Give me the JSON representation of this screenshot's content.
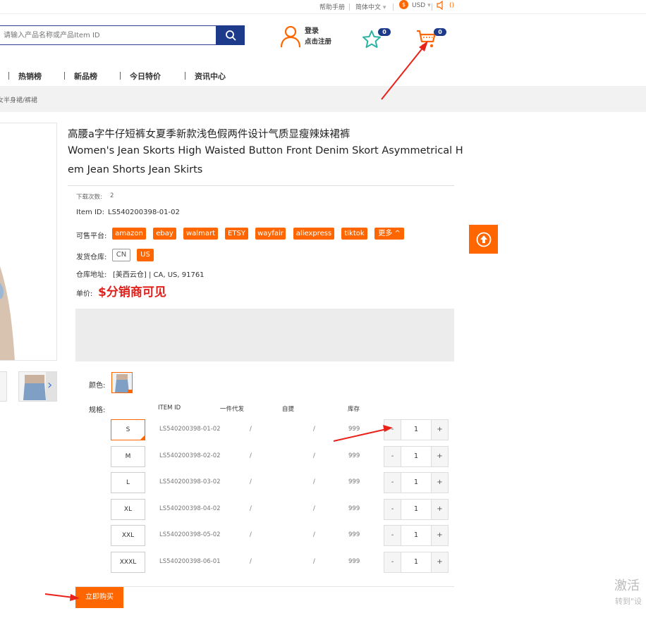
{
  "topbar": {
    "help": "帮助手册",
    "language": "简体中文",
    "currency": "USD",
    "volume": "()"
  },
  "header": {
    "search_placeholder": "请输入产品名称或产品Item ID",
    "login": "登录",
    "register": "点击注册",
    "favorites_count": "0",
    "cart_count": "0"
  },
  "nav": {
    "items": [
      "热销榜",
      "新品榜",
      "今日特价",
      "资讯中心"
    ]
  },
  "breadcrumb": "女半身裙/裤裙",
  "product": {
    "title_cn": "高腰a字牛仔短裤女夏季新款浅色假两件设计气质显瘦辣妹裙裤",
    "title_en_1": "Women's Jean Skorts High Waisted Button Front Denim Skort Asymmetrical H",
    "title_en_2": "em Jean Shorts Jean Skirts",
    "downloads_label": "下载次数:",
    "downloads_value": "2",
    "item_id_label": "Item ID:",
    "item_id_value": "LS540200398-01-02",
    "platforms_label": "可售平台:",
    "platforms": [
      "amazon",
      "ebay",
      "walmart",
      "ETSY",
      "wayfair",
      "aliexpress",
      "tiktok"
    ],
    "more": "更多 ^",
    "warehouse_label": "发货仓库:",
    "warehouses": [
      "CN",
      "US"
    ],
    "address_label": "仓库地址:",
    "address_value": "[美西云仓] | CA, US, 91761",
    "price_label": "单价:",
    "price_value": "$分销商可见",
    "color_label": "颜色:",
    "spec_label": "规格:",
    "spec_headers": [
      "ITEM ID",
      "一件代发",
      "自提",
      "库存"
    ],
    "specs": [
      {
        "size": "S",
        "item_id": "LS540200398-01-02",
        "dropship": "/",
        "pickup": "/",
        "stock": "999",
        "qty": "1"
      },
      {
        "size": "M",
        "item_id": "LS540200398-02-02",
        "dropship": "/",
        "pickup": "/",
        "stock": "999",
        "qty": "1"
      },
      {
        "size": "L",
        "item_id": "LS540200398-03-02",
        "dropship": "/",
        "pickup": "/",
        "stock": "999",
        "qty": "1"
      },
      {
        "size": "XL",
        "item_id": "LS540200398-04-02",
        "dropship": "/",
        "pickup": "/",
        "stock": "999",
        "qty": "1"
      },
      {
        "size": "XXL",
        "item_id": "LS540200398-05-02",
        "dropship": "/",
        "pickup": "/",
        "stock": "999",
        "qty": "1"
      },
      {
        "size": "XXXL",
        "item_id": "LS540200398-06-01",
        "dropship": "/",
        "pickup": "/",
        "stock": "999",
        "qty": "1"
      }
    ],
    "minus": "-",
    "plus": "+",
    "buy_now": "立即购买"
  },
  "watermark": {
    "line1": "激活",
    "line2": "转到\"设"
  },
  "colors": {
    "accent": "#ff6600",
    "brand_blue": "#1e3a8a",
    "price_red": "#e0201b",
    "annotation_red": "#e8221b"
  },
  "icons": [
    "search-icon",
    "user-icon",
    "star-icon",
    "cart-icon",
    "arrow-up-icon",
    "chevron-right-icon",
    "globe-icon",
    "dollar-icon",
    "speaker-icon"
  ]
}
